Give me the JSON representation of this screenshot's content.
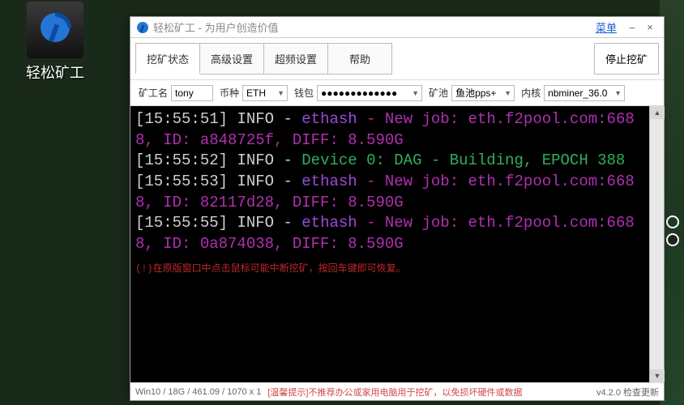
{
  "shortcut": {
    "label": "轻松矿工"
  },
  "titlebar": {
    "title": "轻松矿工 - 为用户创造价值",
    "menu": "菜单",
    "minimize": "–",
    "close": "×"
  },
  "toolbar": {
    "tabs": [
      {
        "label": "挖矿状态",
        "active": true
      },
      {
        "label": "高级设置",
        "active": false
      },
      {
        "label": "超频设置",
        "active": false
      },
      {
        "label": "帮助",
        "active": false
      }
    ],
    "stop": "停止挖矿"
  },
  "fields": {
    "worker_label": "矿工名",
    "worker_value": "tony",
    "coin_label": "币种",
    "coin_value": "ETH",
    "wallet_label": "钱包",
    "wallet_value": "●●●●●●●●●●●●●",
    "pool_label": "矿池",
    "pool_value": "鱼池pps+",
    "kernel_label": "内核",
    "kernel_value": "nbminer_36.0"
  },
  "console": {
    "lines": [
      {
        "ts": "[15:55:51]",
        "level": "INFO -",
        "tag": "ethash",
        "rest": " - New job: eth.f2pool.com:6688, ID: a848725f, DIFF: 8.590G",
        "cls": "job"
      },
      {
        "ts": "[15:55:52]",
        "level": "INFO -",
        "tag": "",
        "rest": " Device 0: DAG - Building, EPOCH 388",
        "cls": "dev"
      },
      {
        "ts": "[15:55:53]",
        "level": "INFO -",
        "tag": "ethash",
        "rest": " - New job: eth.f2pool.com:6688, ID: 82117d28, DIFF: 8.590G",
        "cls": "job"
      },
      {
        "ts": "[15:55:55]",
        "level": "INFO -",
        "tag": "ethash",
        "rest": " - New job: eth.f2pool.com:6688, ID: 0a874038, DIFF: 8.590G",
        "cls": "job"
      }
    ],
    "hint": "(!)在原版窗口中点击鼠标可能中断挖矿，按回车键即可恢复。"
  },
  "status": {
    "sys": "Win10 / 18G / 461.09 / 1070 x 1",
    "warn": "[温馨提示]不推荐办公或家用电脑用于挖矿，以免损坏硬件或数据",
    "version": "v4.2.0 检查更新"
  }
}
